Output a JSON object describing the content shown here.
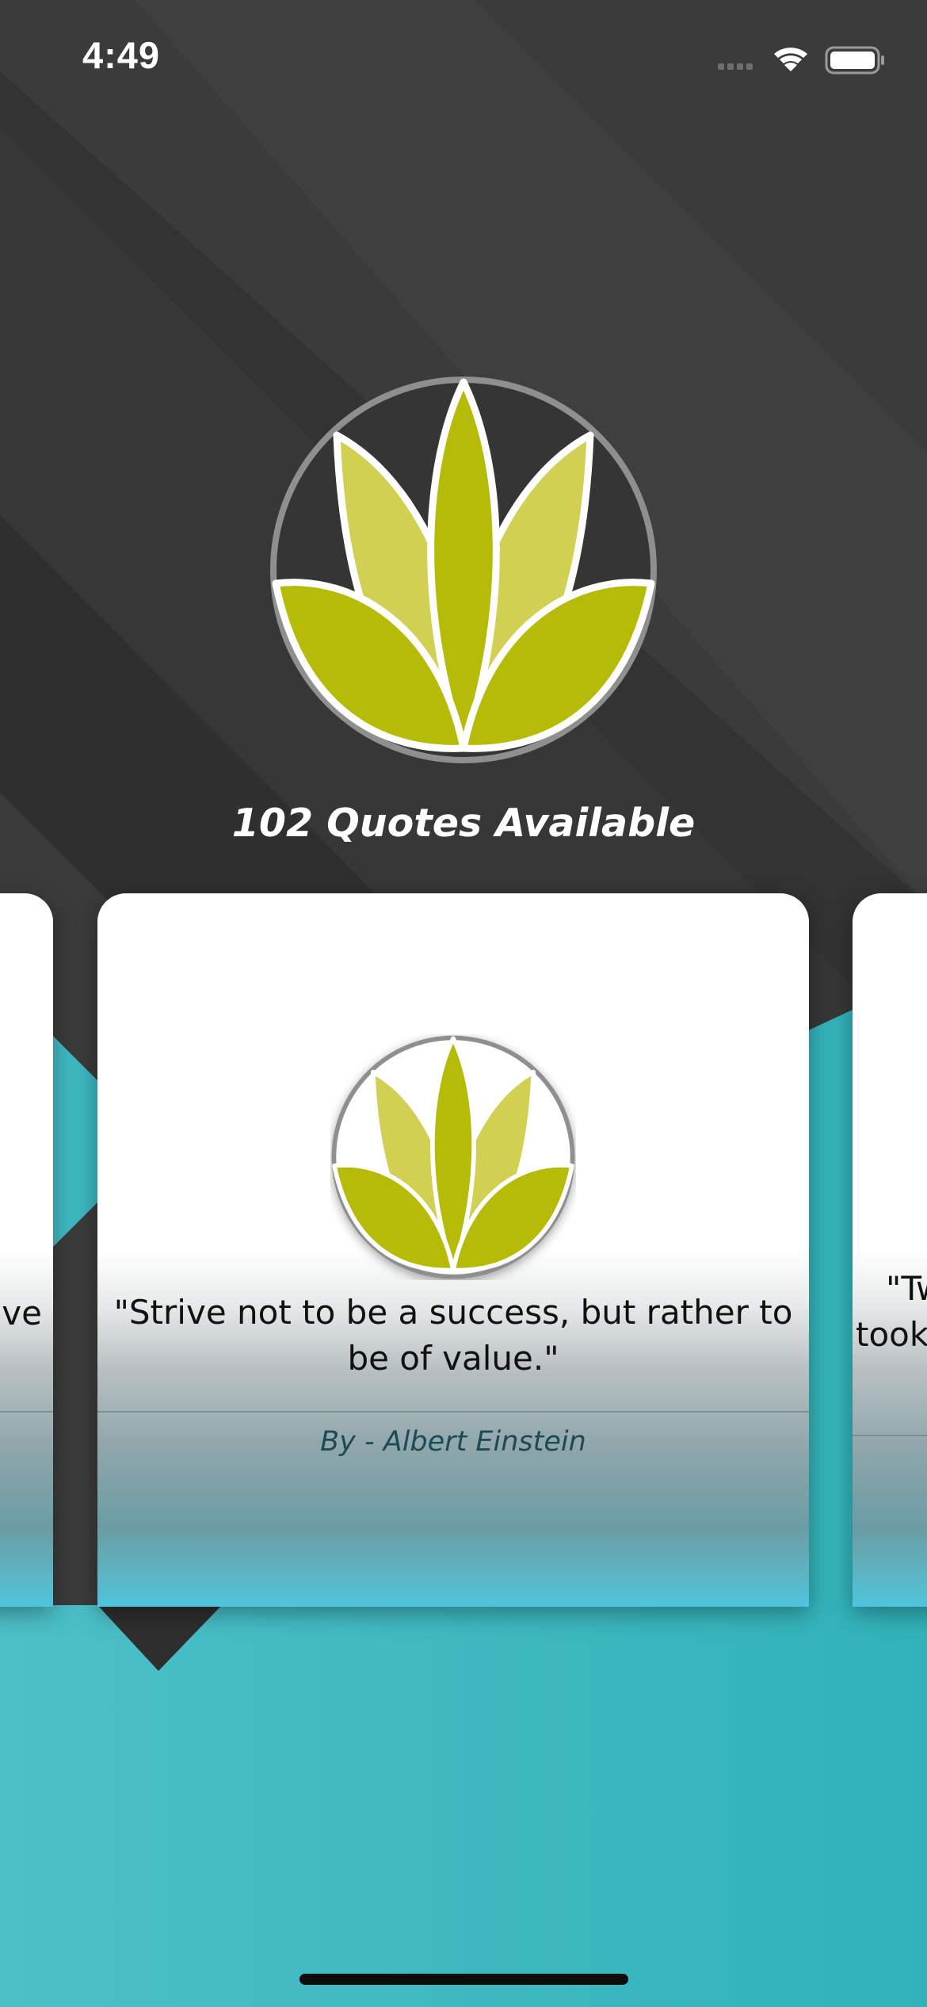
{
  "status_bar": {
    "time": "4:49"
  },
  "header": {
    "quotes_count": "102 Quotes Available"
  },
  "carousel": {
    "current": {
      "quote": "\"Strive not to be a success, but rather to be of value.\"",
      "author": "By - Albert Einstein"
    },
    "previous_peek": {
      "quote_fragment": "ve"
    },
    "next_peek": {
      "quote_line1": "\"Tw",
      "quote_line2": "took"
    }
  },
  "colors": {
    "background_dark": "#3a3a3a",
    "background_teal": "#3bb5bd",
    "logo_green_dark": "#b5bb06",
    "logo_green_light": "#d2d053",
    "card_accent": "#4fc4dc"
  },
  "icons": {
    "logo": "lotus-logo-icon",
    "signal": "cellular-signal-icon",
    "wifi": "wifi-icon",
    "battery": "battery-icon"
  }
}
